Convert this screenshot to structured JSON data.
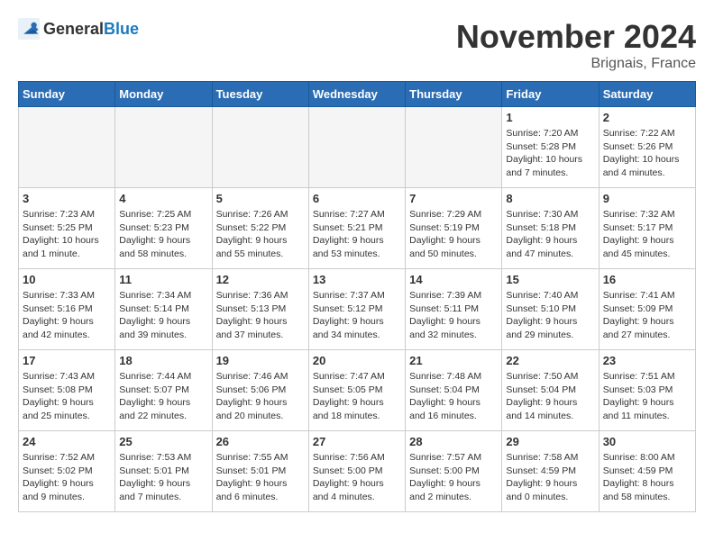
{
  "header": {
    "logo_general": "General",
    "logo_blue": "Blue",
    "title": "November 2024",
    "location": "Brignais, France"
  },
  "weekdays": [
    "Sunday",
    "Monday",
    "Tuesday",
    "Wednesday",
    "Thursday",
    "Friday",
    "Saturday"
  ],
  "weeks": [
    [
      {
        "day": "",
        "info": ""
      },
      {
        "day": "",
        "info": ""
      },
      {
        "day": "",
        "info": ""
      },
      {
        "day": "",
        "info": ""
      },
      {
        "day": "",
        "info": ""
      },
      {
        "day": "1",
        "info": "Sunrise: 7:20 AM\nSunset: 5:28 PM\nDaylight: 10 hours and 7 minutes."
      },
      {
        "day": "2",
        "info": "Sunrise: 7:22 AM\nSunset: 5:26 PM\nDaylight: 10 hours and 4 minutes."
      }
    ],
    [
      {
        "day": "3",
        "info": "Sunrise: 7:23 AM\nSunset: 5:25 PM\nDaylight: 10 hours and 1 minute."
      },
      {
        "day": "4",
        "info": "Sunrise: 7:25 AM\nSunset: 5:23 PM\nDaylight: 9 hours and 58 minutes."
      },
      {
        "day": "5",
        "info": "Sunrise: 7:26 AM\nSunset: 5:22 PM\nDaylight: 9 hours and 55 minutes."
      },
      {
        "day": "6",
        "info": "Sunrise: 7:27 AM\nSunset: 5:21 PM\nDaylight: 9 hours and 53 minutes."
      },
      {
        "day": "7",
        "info": "Sunrise: 7:29 AM\nSunset: 5:19 PM\nDaylight: 9 hours and 50 minutes."
      },
      {
        "day": "8",
        "info": "Sunrise: 7:30 AM\nSunset: 5:18 PM\nDaylight: 9 hours and 47 minutes."
      },
      {
        "day": "9",
        "info": "Sunrise: 7:32 AM\nSunset: 5:17 PM\nDaylight: 9 hours and 45 minutes."
      }
    ],
    [
      {
        "day": "10",
        "info": "Sunrise: 7:33 AM\nSunset: 5:16 PM\nDaylight: 9 hours and 42 minutes."
      },
      {
        "day": "11",
        "info": "Sunrise: 7:34 AM\nSunset: 5:14 PM\nDaylight: 9 hours and 39 minutes."
      },
      {
        "day": "12",
        "info": "Sunrise: 7:36 AM\nSunset: 5:13 PM\nDaylight: 9 hours and 37 minutes."
      },
      {
        "day": "13",
        "info": "Sunrise: 7:37 AM\nSunset: 5:12 PM\nDaylight: 9 hours and 34 minutes."
      },
      {
        "day": "14",
        "info": "Sunrise: 7:39 AM\nSunset: 5:11 PM\nDaylight: 9 hours and 32 minutes."
      },
      {
        "day": "15",
        "info": "Sunrise: 7:40 AM\nSunset: 5:10 PM\nDaylight: 9 hours and 29 minutes."
      },
      {
        "day": "16",
        "info": "Sunrise: 7:41 AM\nSunset: 5:09 PM\nDaylight: 9 hours and 27 minutes."
      }
    ],
    [
      {
        "day": "17",
        "info": "Sunrise: 7:43 AM\nSunset: 5:08 PM\nDaylight: 9 hours and 25 minutes."
      },
      {
        "day": "18",
        "info": "Sunrise: 7:44 AM\nSunset: 5:07 PM\nDaylight: 9 hours and 22 minutes."
      },
      {
        "day": "19",
        "info": "Sunrise: 7:46 AM\nSunset: 5:06 PM\nDaylight: 9 hours and 20 minutes."
      },
      {
        "day": "20",
        "info": "Sunrise: 7:47 AM\nSunset: 5:05 PM\nDaylight: 9 hours and 18 minutes."
      },
      {
        "day": "21",
        "info": "Sunrise: 7:48 AM\nSunset: 5:04 PM\nDaylight: 9 hours and 16 minutes."
      },
      {
        "day": "22",
        "info": "Sunrise: 7:50 AM\nSunset: 5:04 PM\nDaylight: 9 hours and 14 minutes."
      },
      {
        "day": "23",
        "info": "Sunrise: 7:51 AM\nSunset: 5:03 PM\nDaylight: 9 hours and 11 minutes."
      }
    ],
    [
      {
        "day": "24",
        "info": "Sunrise: 7:52 AM\nSunset: 5:02 PM\nDaylight: 9 hours and 9 minutes."
      },
      {
        "day": "25",
        "info": "Sunrise: 7:53 AM\nSunset: 5:01 PM\nDaylight: 9 hours and 7 minutes."
      },
      {
        "day": "26",
        "info": "Sunrise: 7:55 AM\nSunset: 5:01 PM\nDaylight: 9 hours and 6 minutes."
      },
      {
        "day": "27",
        "info": "Sunrise: 7:56 AM\nSunset: 5:00 PM\nDaylight: 9 hours and 4 minutes."
      },
      {
        "day": "28",
        "info": "Sunrise: 7:57 AM\nSunset: 5:00 PM\nDaylight: 9 hours and 2 minutes."
      },
      {
        "day": "29",
        "info": "Sunrise: 7:58 AM\nSunset: 4:59 PM\nDaylight: 9 hours and 0 minutes."
      },
      {
        "day": "30",
        "info": "Sunrise: 8:00 AM\nSunset: 4:59 PM\nDaylight: 8 hours and 58 minutes."
      }
    ]
  ]
}
